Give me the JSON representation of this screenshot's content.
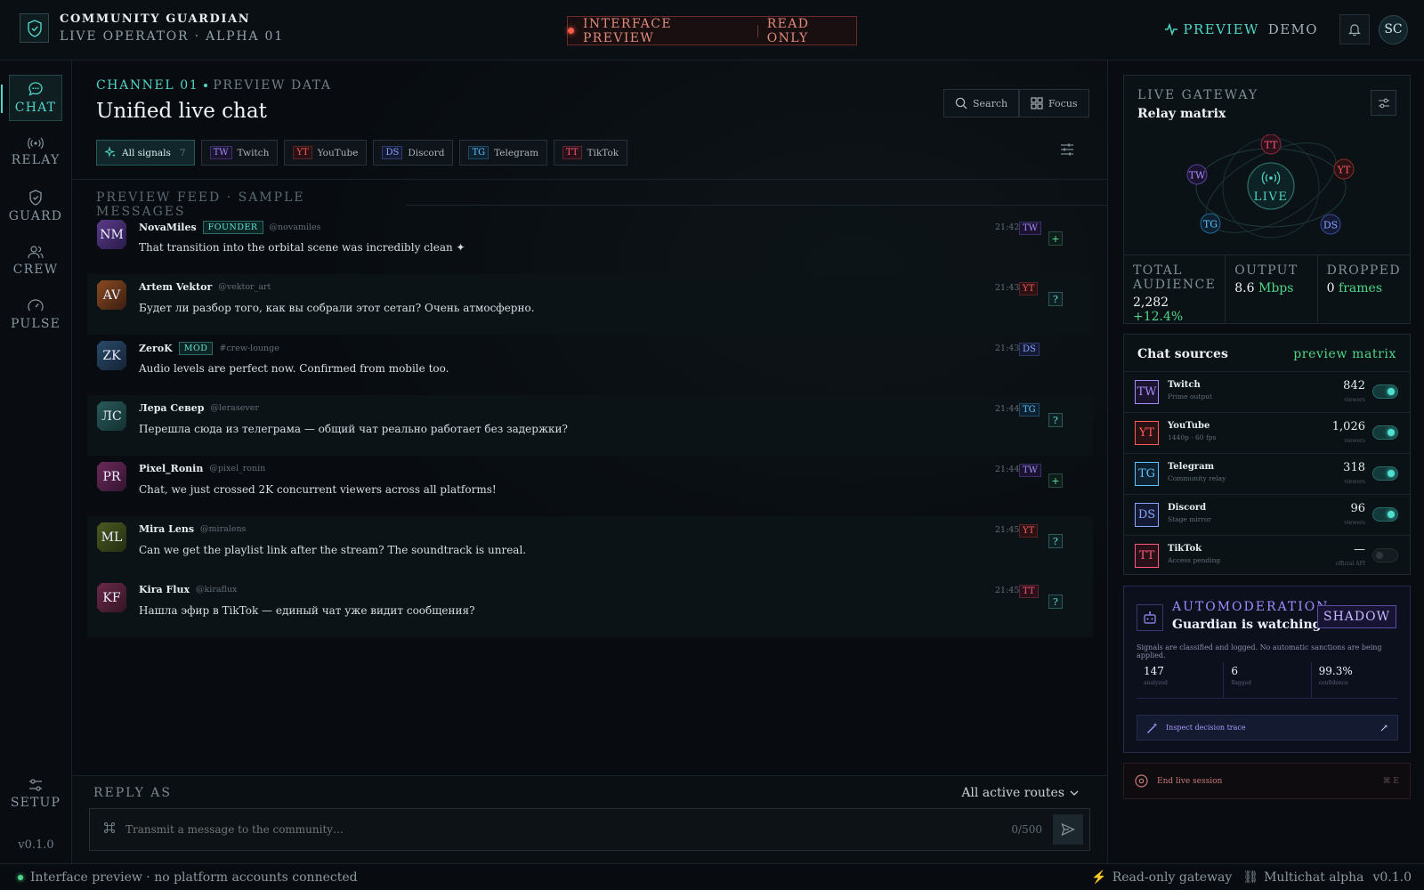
{
  "header": {
    "brand_title": "COMMUNITY GUARDIAN",
    "brand_subtitle": "LIVE OPERATOR · ALPHA 01",
    "preview_label": "INTERFACE PREVIEW",
    "readonly_label": "READ ONLY",
    "mode_preview": "PREVIEW",
    "mode_demo": "DEMO",
    "avatar_initials": "SC"
  },
  "nav": {
    "items": [
      {
        "label": "CHAT",
        "icon": "chat-bubble-icon"
      },
      {
        "label": "RELAY",
        "icon": "broadcast-icon"
      },
      {
        "label": "GUARD",
        "icon": "shield-icon"
      },
      {
        "label": "CREW",
        "icon": "users-icon"
      },
      {
        "label": "PULSE",
        "icon": "gauge-icon"
      }
    ],
    "setup_label": "SETUP",
    "version": "v0.1.0"
  },
  "main": {
    "channel": "CHANNEL 01",
    "channel_sub": "PREVIEW DATA",
    "title": "Unified live chat",
    "search_label": "Search",
    "focus_label": "Focus",
    "chips": [
      {
        "label": "All signals",
        "count": "7"
      },
      {
        "tag": "TW",
        "label": "Twitch"
      },
      {
        "tag": "YT",
        "label": "YouTube"
      },
      {
        "tag": "DS",
        "label": "Discord"
      },
      {
        "tag": "TG",
        "label": "Telegram"
      },
      {
        "tag": "TT",
        "label": "TikTok"
      }
    ],
    "feed_label": "PREVIEW FEED · SAMPLE MESSAGES",
    "messages": [
      {
        "initials": "NM",
        "name": "NovaMiles",
        "badge": "FOUNDER",
        "handle": "@novamiles",
        "text": "That transition into the orbital scene was incredibly clean ✦",
        "time": "21:42",
        "platform": "TW",
        "action": "+"
      },
      {
        "initials": "AV",
        "name": "Artem Vektor",
        "badge": "",
        "handle": "@vektor_art",
        "text": "Будет ли разбор того, как вы собрали этот сетап? Очень атмосферно.",
        "time": "21:43",
        "platform": "YT",
        "action": "?"
      },
      {
        "initials": "ZK",
        "name": "ZeroK",
        "badge": "MOD",
        "handle": "#crew-lounge",
        "text": "Audio levels are perfect now. Confirmed from mobile too.",
        "time": "21:43",
        "platform": "DS",
        "action": ""
      },
      {
        "initials": "ЛС",
        "name": "Лера Север",
        "badge": "",
        "handle": "@lerasever",
        "text": "Перешла сюда из телеграма — общий чат реально работает без задержки?",
        "time": "21:44",
        "platform": "TG",
        "action": "?"
      },
      {
        "initials": "PR",
        "name": "Pixel_Ronin",
        "badge": "",
        "handle": "@pixel_ronin",
        "text": "Chat, we just crossed 2K concurrent viewers across all platforms!",
        "time": "21:44",
        "platform": "TW",
        "action": "+"
      },
      {
        "initials": "ML",
        "name": "Mira Lens",
        "badge": "",
        "handle": "@miralens",
        "text": "Can we get the playlist link after the stream? The soundtrack is unreal.",
        "time": "21:45",
        "platform": "YT",
        "action": "?"
      },
      {
        "initials": "KF",
        "name": "Kira Flux",
        "badge": "",
        "handle": "@kiraflux",
        "text": "Нашла эфир в TikTok — единый чат уже видит сообщения?",
        "time": "21:45",
        "platform": "TT",
        "action": "?"
      }
    ],
    "reply_label": "REPLY AS",
    "reply_route": "All active routes",
    "reply_placeholder": "Transmit a message to the community…",
    "reply_count": "0/500"
  },
  "gateway": {
    "label": "LIVE GATEWAY",
    "title": "Relay matrix",
    "center": "LIVE",
    "nodes": [
      "TT",
      "YT",
      "TW",
      "TG",
      "DS"
    ],
    "stats": [
      {
        "label": "TOTAL AUDIENCE",
        "value": "2,282",
        "extra": "+12.4%"
      },
      {
        "label": "OUTPUT",
        "value": "8.6",
        "extra": "Mbps"
      },
      {
        "label": "DROPPED",
        "value": "0",
        "extra": "frames"
      }
    ]
  },
  "sources": {
    "title": "Chat sources",
    "meta": "preview matrix",
    "items": [
      {
        "tag": "TW",
        "name": "Twitch",
        "sub": "Prime output",
        "value": "842",
        "unit": "viewers",
        "enabled": true
      },
      {
        "tag": "YT",
        "name": "YouTube",
        "sub": "1440p · 60 fps",
        "value": "1,026",
        "unit": "viewers",
        "enabled": true
      },
      {
        "tag": "TG",
        "name": "Telegram",
        "sub": "Community relay",
        "value": "318",
        "unit": "viewers",
        "enabled": true
      },
      {
        "tag": "DS",
        "name": "Discord",
        "sub": "Stage mirror",
        "value": "96",
        "unit": "viewers",
        "enabled": true
      },
      {
        "tag": "TT",
        "name": "TikTok",
        "sub": "Access pending",
        "value": "—",
        "unit": "official API",
        "enabled": false
      }
    ]
  },
  "automod": {
    "label": "AUTOMODERATION",
    "title": "Guardian is watching",
    "mode": "SHADOW",
    "desc": "Signals are classified and logged. No automatic sanctions are being applied.",
    "stats": [
      {
        "value": "147",
        "label": "analyzed"
      },
      {
        "value": "6",
        "label": "flagged"
      },
      {
        "value": "99.3%",
        "label": "confidence"
      }
    ],
    "inspect_label": "Inspect decision trace"
  },
  "end_session": {
    "label": "End live session",
    "shortcut": "⌘ E"
  },
  "status": {
    "left": "Interface preview · no platform accounts connected",
    "gateway": "Read-only gateway",
    "multichat": "Multichat alpha",
    "version": "v0.1.0"
  },
  "colors": {
    "accent": "#4fd6c6",
    "positive": "#4fd68a",
    "danger": "#ff5a4a",
    "automod": "#a08cff"
  }
}
